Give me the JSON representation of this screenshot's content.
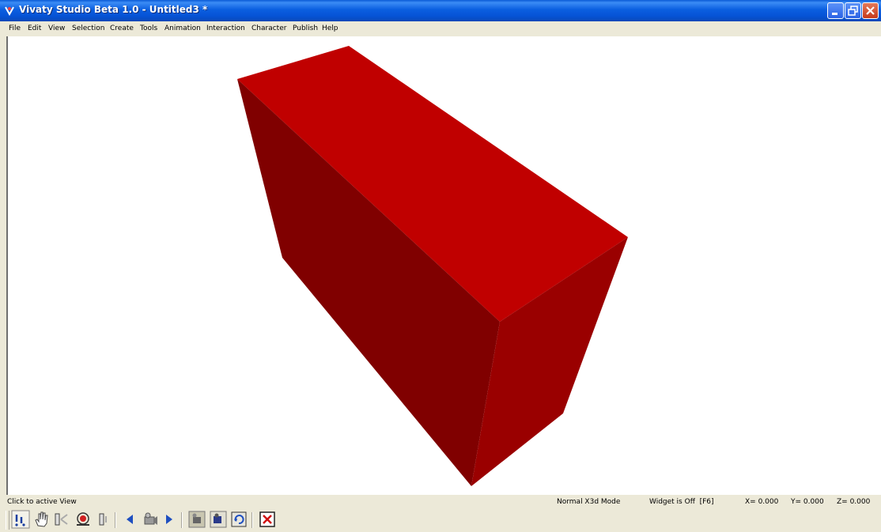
{
  "window": {
    "title": "Vivaty Studio Beta 1.0 - Untitled3 *",
    "app_icon": "vivaty-app-icon",
    "controls": [
      "minimize-icon",
      "restore-icon",
      "close-icon"
    ]
  },
  "menu": {
    "items": [
      "File",
      "Edit",
      "View",
      "Selection",
      "Create",
      "Tools",
      "Animation",
      "Interaction",
      "Character",
      "Publish",
      "Help"
    ]
  },
  "viewport": {
    "background": "#ffffff",
    "object": {
      "shape": "box",
      "colors": {
        "top": "#c00000",
        "front": "#800000",
        "side": "#9a0000"
      }
    }
  },
  "status": {
    "hint": "Click to active View",
    "mode": "Normal X3d Mode",
    "widget": "Widget is Off  [F6]",
    "x": "X= 0.000",
    "y": "Y= 0.000",
    "z": "Z= 0.000"
  },
  "toolbar": {
    "tools": [
      "walk-icon",
      "pan-hand-icon",
      "slide-icon",
      "examine-icon",
      "tilt-icon",
      "previous-viewpoint-icon",
      "viewpoint-camera-icon",
      "next-viewpoint-icon",
      "straighten-icon",
      "fit-view-icon",
      "reset-view-icon",
      "stop-icon"
    ]
  }
}
